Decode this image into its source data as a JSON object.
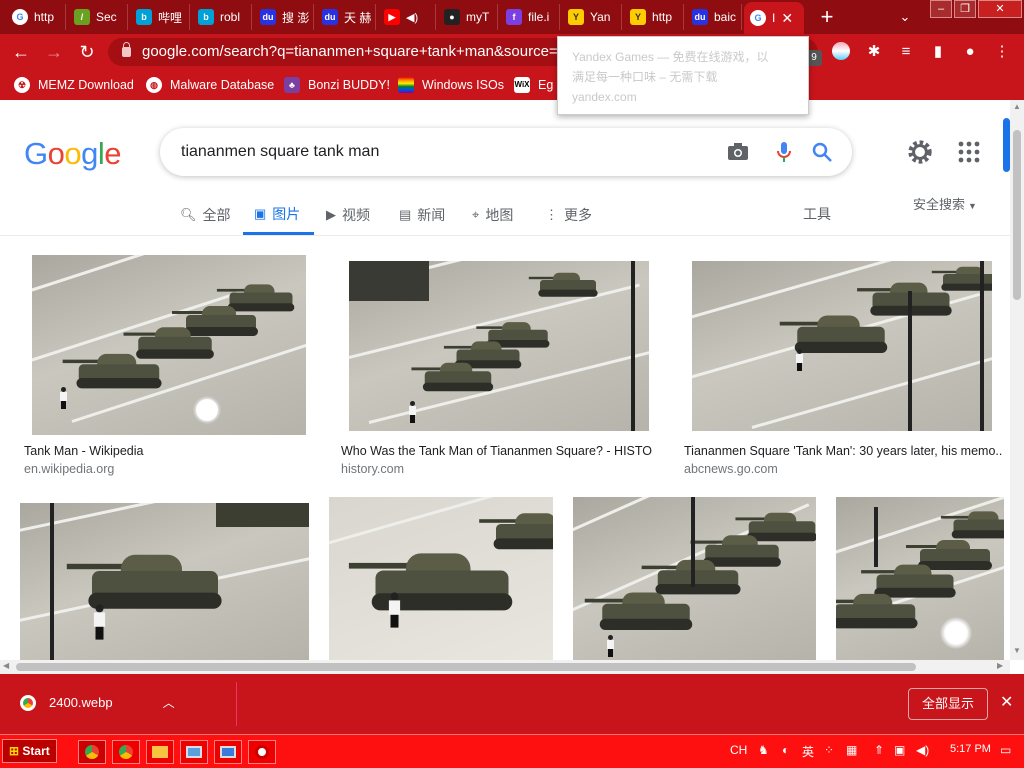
{
  "browser": {
    "tabs": [
      {
        "label": "http",
        "icon": "google-icon",
        "color": "#4285f4"
      },
      {
        "label": "Sec",
        "icon": "malware-icon",
        "color": "#6aa121"
      },
      {
        "label": "哔哩",
        "icon": "bilibili-icon",
        "color": "#00a1d6"
      },
      {
        "label": "robl",
        "icon": "bilibili-icon",
        "color": "#00a1d6"
      },
      {
        "label": "搜 澎",
        "icon": "baidu-icon",
        "color": "#2932e1"
      },
      {
        "label": "天 赫",
        "icon": "baidu-icon",
        "color": "#2932e1"
      },
      {
        "label": "",
        "icon": "youtube-icon",
        "color": "#ff0000"
      },
      {
        "label": "myT",
        "icon": "github-icon",
        "color": "#222222"
      },
      {
        "label": "file.i",
        "icon": "file-icon",
        "color": "#7b3fe4"
      },
      {
        "label": "Yan",
        "icon": "yandex-games-icon",
        "color": "#ffcc00"
      },
      {
        "label": "http",
        "icon": "yandex-games-icon",
        "color": "#ffcc00"
      },
      {
        "label": "baic",
        "icon": "baidu-icon",
        "color": "#2932e1"
      },
      {
        "label": "I",
        "icon": "google-icon",
        "color": "#4285f4",
        "active": true
      }
    ],
    "url": "google.com/search?q=tiananmen+square+tank+man&source=lnms",
    "extension_badge": "9",
    "bookmarks": [
      {
        "label": "MEMZ Download",
        "icon": "memz-icon"
      },
      {
        "label": "Malware Database",
        "icon": "globe-icon"
      },
      {
        "label": "Bonzi BUDDY!",
        "icon": "bonzi-icon"
      },
      {
        "label": "Windows ISOs",
        "icon": "windows-icon"
      },
      {
        "label": "Eg",
        "icon": "wix-icon"
      }
    ],
    "popup": {
      "title": "Yandex Games — 免费在线游戏，以",
      "line2": "满足每一种口味 – 无需下载",
      "domain": "yandex.com"
    }
  },
  "google": {
    "logo": "Google",
    "query": "tiananmen square tank man",
    "tabs": [
      {
        "label": "全部",
        "icon": "search-icon"
      },
      {
        "label": "图片",
        "icon": "image-icon",
        "active": true
      },
      {
        "label": "视频",
        "icon": "video-icon"
      },
      {
        "label": "新闻",
        "icon": "news-icon"
      },
      {
        "label": "地图",
        "icon": "map-pin-icon"
      },
      {
        "label": "更多",
        "icon": "more-dots-icon"
      }
    ],
    "tools": "工具",
    "safe_search": "安全搜索",
    "results": [
      {
        "caption": "Tank Man - Wikipedia",
        "source": "en.wikipedia.org"
      },
      {
        "caption": "Who Was the Tank Man of Tiananmen Square? - HISTO...",
        "source": "history.com"
      },
      {
        "caption": "Tiananmen Square 'Tank Man': 30 years later, his memo...",
        "source": "abcnews.go.com"
      },
      {
        "caption": "",
        "source": ""
      },
      {
        "caption": "",
        "source": ""
      },
      {
        "caption": "",
        "source": ""
      },
      {
        "caption": "",
        "source": ""
      }
    ]
  },
  "downloads": {
    "file": "2400.webp",
    "show_all": "全部显示"
  },
  "taskbar": {
    "start": "Start",
    "lang": "CH",
    "ime": "英",
    "time": "5:17 PM"
  },
  "colors": {
    "theme_dark": "#8f0d10",
    "theme": "#c8151b",
    "google_blue": "#1a73e8",
    "taskbar": "#ff1010"
  }
}
